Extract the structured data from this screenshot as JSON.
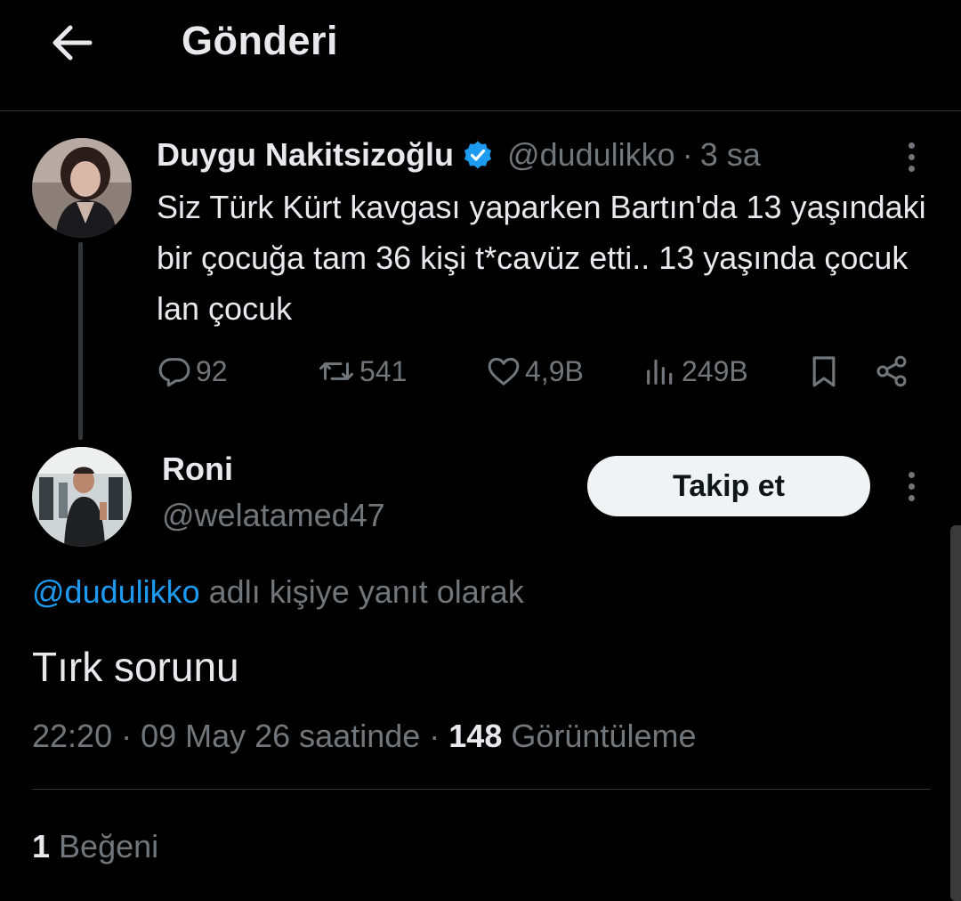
{
  "header": {
    "title": "Gönderi",
    "back_icon": "arrow-left-icon"
  },
  "parent_post": {
    "author_name": "Duygu Nakitsizoğlu",
    "verified": true,
    "handle": "@dudulikko",
    "separator": "·",
    "time": "3 sa",
    "text": "Siz Türk Kürt kavgası yaparken Bartın'da 13 yaşındaki bir çocuğa tam 36 kişi t*cavüz etti.. 13 yaşında çocuk lan çocuk",
    "stats": {
      "replies": "92",
      "reposts": "541",
      "likes": "4,9B",
      "views": "249B"
    }
  },
  "reply_post": {
    "author_name": "Roni",
    "handle": "@welatamed47",
    "follow_label": "Takip et",
    "reply_to_mention": "@dudulikko",
    "reply_to_suffix": " adlı kişiye yanıt olarak",
    "text": "Tırk sorunu",
    "timestamp": "22:20 · 09 May 26 saatinde · ",
    "views_count": "148",
    "views_label": " Görüntüleme",
    "likes_count": "1",
    "likes_label": " Beğeni"
  },
  "colors": {
    "background": "#000000",
    "text_primary": "#e7e9ea",
    "text_secondary": "#71767b",
    "accent": "#1d9bf0",
    "divider": "#2f3336"
  }
}
